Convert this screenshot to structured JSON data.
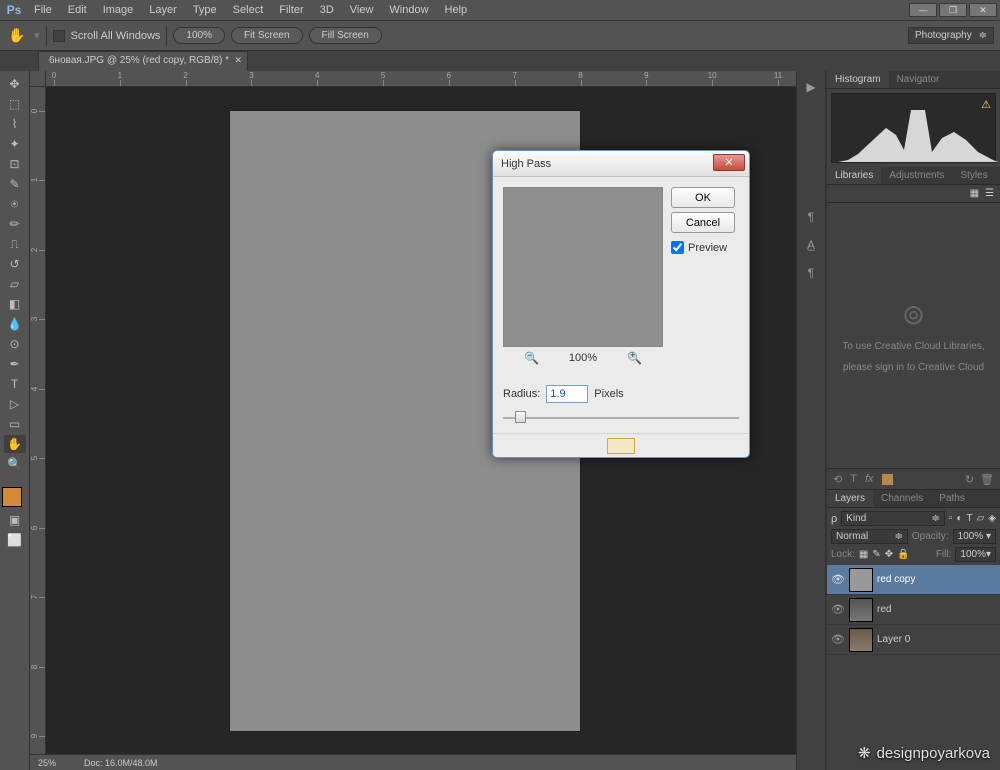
{
  "app": {
    "logo": "Ps"
  },
  "menu": [
    "File",
    "Edit",
    "Image",
    "Layer",
    "Type",
    "Select",
    "Filter",
    "3D",
    "View",
    "Window",
    "Help"
  ],
  "options": {
    "scroll_all": "Scroll All Windows",
    "zoom_pct": "100%",
    "fit": "Fit Screen",
    "fill": "Fill Screen",
    "workspace": "Photography"
  },
  "doc_tab": "6новая.JPG @ 25% (red copy, RGB/8) *",
  "ruler_h": [
    "0",
    "1",
    "2",
    "3",
    "4",
    "5",
    "6",
    "7",
    "8",
    "9",
    "10",
    "11"
  ],
  "ruler_v": [
    "0",
    "1",
    "2",
    "3",
    "4",
    "5",
    "6",
    "7",
    "8",
    "9"
  ],
  "status": {
    "zoom": "25%",
    "size": "Doc: 16.0M/48.0M"
  },
  "panels": {
    "hist_tabs": [
      "Histogram",
      "Navigator"
    ],
    "lib_tabs": [
      "Libraries",
      "Adjustments",
      "Styles"
    ],
    "lib_msg1": "To use Creative Cloud Libraries,",
    "lib_msg2": "please sign in to Creative Cloud",
    "layer_tabs": [
      "Layers",
      "Channels",
      "Paths"
    ],
    "kind": "Kind",
    "blend": "Normal",
    "opacity_lbl": "Opacity:",
    "opacity_val": "100%",
    "lock_lbl": "Lock:",
    "fill_lbl": "Fill:",
    "fill_val": "100%",
    "layers": [
      {
        "name": "red copy"
      },
      {
        "name": "red"
      },
      {
        "name": "Layer 0"
      }
    ]
  },
  "dialog": {
    "title": "High Pass",
    "ok": "OK",
    "cancel": "Cancel",
    "preview": "Preview",
    "zoom": "100%",
    "radius_lbl": "Radius:",
    "radius_val": "1.9",
    "unit": "Pixels"
  },
  "watermark": "designpoyarkova"
}
